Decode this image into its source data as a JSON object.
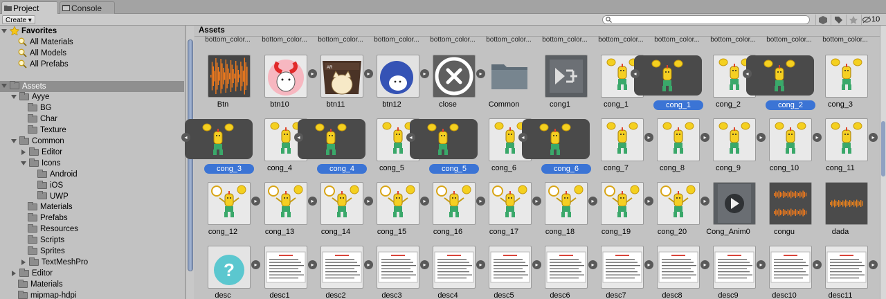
{
  "tabs": {
    "project": "Project",
    "console": "Console"
  },
  "toolbar": {
    "create": "Create",
    "search_placeholder": "",
    "count": "10"
  },
  "tree": [
    {
      "label": "Favorites",
      "indent": 0,
      "kind": "star",
      "bold": true,
      "open": true
    },
    {
      "label": "All Materials",
      "indent": 1,
      "kind": "search"
    },
    {
      "label": "All Models",
      "indent": 1,
      "kind": "search"
    },
    {
      "label": "All Prefabs",
      "indent": 1,
      "kind": "search"
    },
    {
      "label": "",
      "indent": 0,
      "kind": "blank"
    },
    {
      "label": "Assets",
      "indent": 0,
      "kind": "folder",
      "open": true,
      "selected": true
    },
    {
      "label": "Ayye",
      "indent": 1,
      "kind": "folder",
      "open": true
    },
    {
      "label": "BG",
      "indent": 2,
      "kind": "folder"
    },
    {
      "label": "Char",
      "indent": 2,
      "kind": "folder"
    },
    {
      "label": "Texture",
      "indent": 2,
      "kind": "folder"
    },
    {
      "label": "Common",
      "indent": 1,
      "kind": "folder",
      "open": true
    },
    {
      "label": "Editor",
      "indent": 2,
      "kind": "folder",
      "closed": true
    },
    {
      "label": "Icons",
      "indent": 2,
      "kind": "folder",
      "open": true
    },
    {
      "label": "Android",
      "indent": 3,
      "kind": "folder"
    },
    {
      "label": "iOS",
      "indent": 3,
      "kind": "folder"
    },
    {
      "label": "UWP",
      "indent": 3,
      "kind": "folder"
    },
    {
      "label": "Materials",
      "indent": 2,
      "kind": "folder"
    },
    {
      "label": "Prefabs",
      "indent": 2,
      "kind": "folder"
    },
    {
      "label": "Resources",
      "indent": 2,
      "kind": "folder"
    },
    {
      "label": "Scripts",
      "indent": 2,
      "kind": "folder"
    },
    {
      "label": "Sprites",
      "indent": 2,
      "kind": "folder"
    },
    {
      "label": "TextMeshPro",
      "indent": 2,
      "kind": "folder",
      "closed": true
    },
    {
      "label": "Editor",
      "indent": 1,
      "kind": "folder",
      "closed": true
    },
    {
      "label": "Materials",
      "indent": 1,
      "kind": "folder"
    },
    {
      "label": "mipmap-hdpi",
      "indent": 1,
      "kind": "folder"
    }
  ],
  "assets_title": "Assets",
  "partial_labels": [
    "bottom_color...",
    "bottom_color...",
    "bottom_color...",
    "bottom_color...",
    "bottom_color...",
    "bottom_color...",
    "bottom_color...",
    "bottom_color...",
    "bottom_color...",
    "bottom_color...",
    "bottom_color...",
    "bottom_color..."
  ],
  "rows": [
    [
      {
        "label": "Btn",
        "type": "audio"
      },
      {
        "label": "btn10",
        "type": "bunny",
        "arrow": "r"
      },
      {
        "label": "btn11",
        "type": "cat",
        "arrow": "r"
      },
      {
        "label": "btn12",
        "type": "blue",
        "arrow": "r"
      },
      {
        "label": "close",
        "type": "close",
        "arrow": "r"
      },
      {
        "label": "Common",
        "type": "folder"
      },
      {
        "label": "cong1",
        "type": "anim"
      },
      {
        "label": "cong_1",
        "type": "char",
        "arrow": "r"
      },
      {
        "label": "cong_1",
        "type": "charwide",
        "selected": true
      },
      {
        "label": "cong_2",
        "type": "char",
        "arrow": "r"
      },
      {
        "label": "cong_2",
        "type": "charwide",
        "selected": true
      },
      {
        "label": "cong_3",
        "type": "char"
      }
    ],
    [
      {
        "label": "cong_3",
        "type": "charwide",
        "selected": true
      },
      {
        "label": "cong_4",
        "type": "char",
        "arrow": "r"
      },
      {
        "label": "cong_4",
        "type": "charwide",
        "selected": true
      },
      {
        "label": "cong_5",
        "type": "char",
        "arrow": "r"
      },
      {
        "label": "cong_5",
        "type": "charwide",
        "selected": true
      },
      {
        "label": "cong_6",
        "type": "char",
        "arrow": "r"
      },
      {
        "label": "cong_6",
        "type": "charwide",
        "selected": true
      },
      {
        "label": "cong_7",
        "type": "char",
        "arrow": "r"
      },
      {
        "label": "cong_8",
        "type": "char",
        "arrow": "r"
      },
      {
        "label": "cong_9",
        "type": "char",
        "arrow": "r"
      },
      {
        "label": "cong_10",
        "type": "char",
        "arrow": "r"
      },
      {
        "label": "cong_11",
        "type": "char",
        "arrow": "r"
      }
    ],
    [
      {
        "label": "cong_12",
        "type": "char2",
        "arrow": "r"
      },
      {
        "label": "cong_13",
        "type": "char2",
        "arrow": "r"
      },
      {
        "label": "cong_14",
        "type": "char2",
        "arrow": "r"
      },
      {
        "label": "cong_15",
        "type": "char2",
        "arrow": "r"
      },
      {
        "label": "cong_16",
        "type": "char2",
        "arrow": "r"
      },
      {
        "label": "cong_17",
        "type": "char2",
        "arrow": "r"
      },
      {
        "label": "cong_18",
        "type": "char2",
        "arrow": "r"
      },
      {
        "label": "cong_19",
        "type": "char2",
        "arrow": "r"
      },
      {
        "label": "cong_20",
        "type": "char2",
        "arrow": "r"
      },
      {
        "label": "Cong_Anim0",
        "type": "play"
      },
      {
        "label": "congu",
        "type": "audio2"
      },
      {
        "label": "dada",
        "type": "audio3"
      }
    ],
    [
      {
        "label": "desc",
        "type": "help",
        "arrow": "r"
      },
      {
        "label": "desc1",
        "type": "doc",
        "arrow": "r"
      },
      {
        "label": "desc2",
        "type": "doc",
        "arrow": "r"
      },
      {
        "label": "desc3",
        "type": "doc",
        "arrow": "r"
      },
      {
        "label": "desc4",
        "type": "doc",
        "arrow": "r"
      },
      {
        "label": "desc5",
        "type": "doc",
        "arrow": "r"
      },
      {
        "label": "desc6",
        "type": "doc",
        "arrow": "r"
      },
      {
        "label": "desc7",
        "type": "doc",
        "arrow": "r"
      },
      {
        "label": "desc8",
        "type": "doc",
        "arrow": "r"
      },
      {
        "label": "desc9",
        "type": "doc",
        "arrow": "r"
      },
      {
        "label": "desc10",
        "type": "doc",
        "arrow": "r"
      },
      {
        "label": "desc11",
        "type": "doc",
        "arrow": "r"
      }
    ]
  ],
  "colors": {
    "selection": "#3b74d5",
    "orange": "#f07a1c",
    "dark": "#4a4a4a",
    "tree_selected": "#8f8f8f"
  }
}
